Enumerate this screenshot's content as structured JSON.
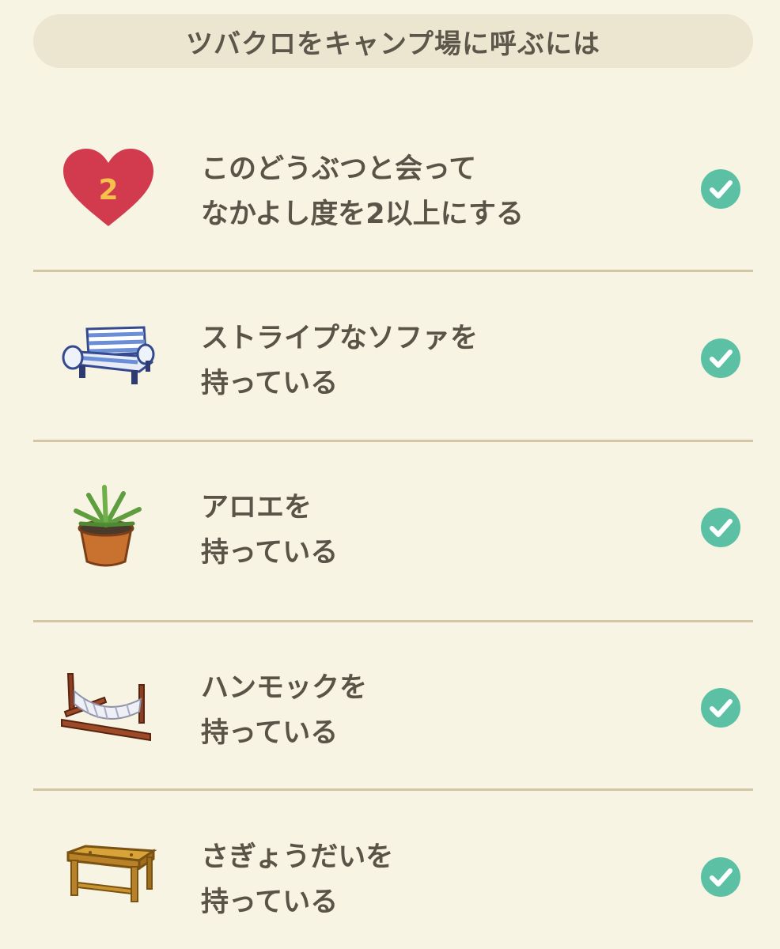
{
  "header": {
    "title": "ツバクロをキャンプ場に呼ぶには"
  },
  "requirements": [
    {
      "icon": "heart-level-icon",
      "badge": "2",
      "line1": "このどうぶつと会って",
      "line2": "なかよし度を2以上にする",
      "completed": true
    },
    {
      "icon": "striped-sofa-icon",
      "line1": "ストライプなソファを",
      "line2": "持っている",
      "completed": true
    },
    {
      "icon": "aloe-plant-icon",
      "line1": "アロエを",
      "line2": "持っている",
      "completed": true
    },
    {
      "icon": "hammock-icon",
      "line1": "ハンモックを",
      "line2": "持っている",
      "completed": true
    },
    {
      "icon": "workbench-icon",
      "line1": "さぎょうだいを",
      "line2": "持っている",
      "completed": true
    }
  ],
  "colors": {
    "background": "#f8f4e3",
    "header_bg": "#ece5cf",
    "check": "#5cc1a4",
    "heart": "#d23b4d",
    "heart_number": "#f4c24a",
    "divider": "#d2c6a4"
  }
}
